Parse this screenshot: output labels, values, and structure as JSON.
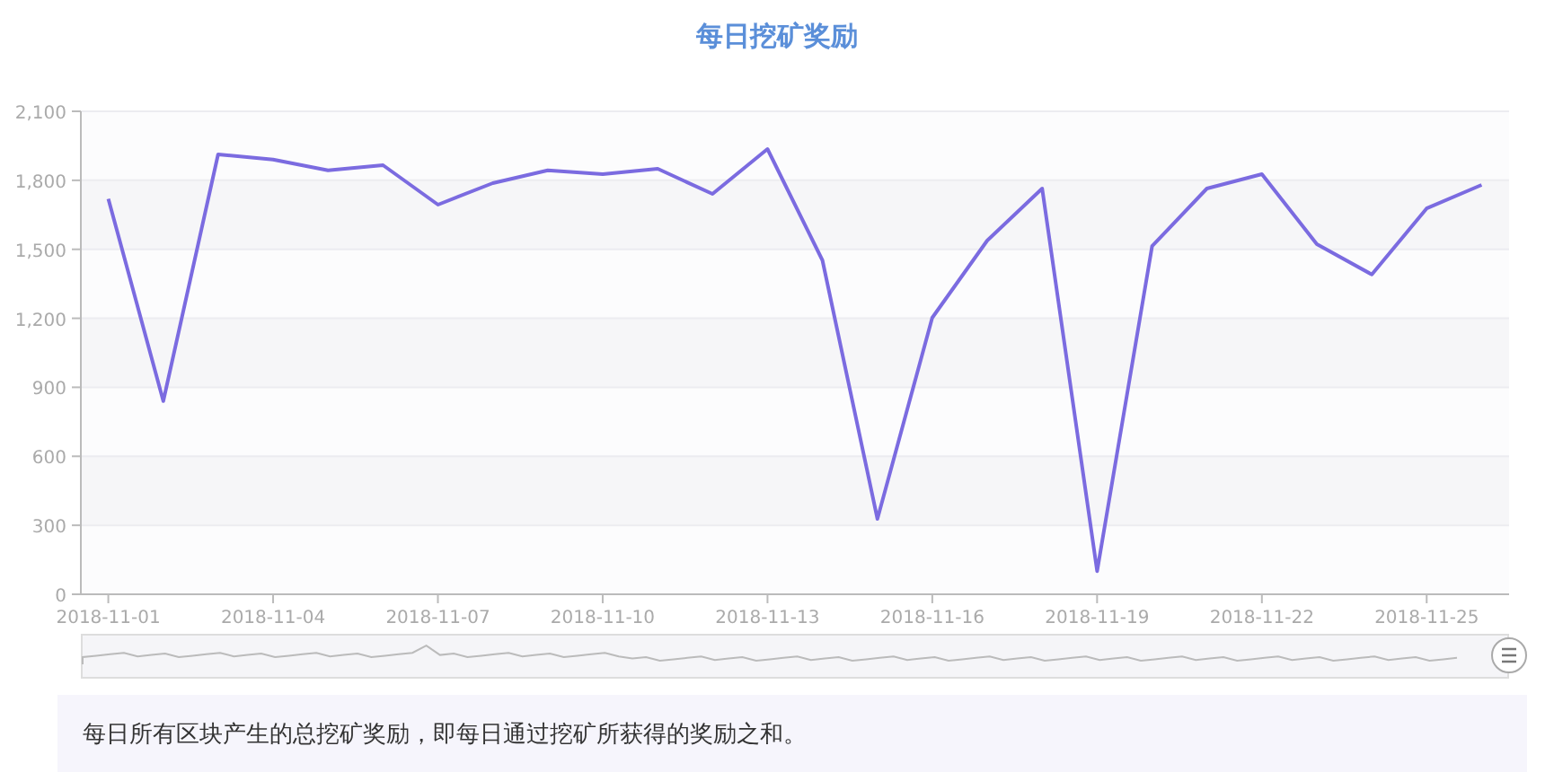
{
  "title": "每日挖矿奖励",
  "chart": {
    "chart_data": {
      "type": "line",
      "categories": [
        "2018-11-01",
        null,
        null,
        "2018-11-04",
        null,
        null,
        "2018-11-07",
        null,
        null,
        "2018-11-10",
        null,
        null,
        "2018-11-13",
        null,
        null,
        "2018-11-16",
        null,
        null,
        "2018-11-19",
        null,
        null,
        "2018-11-22",
        null,
        null,
        "2018-11-25",
        null
      ],
      "series": [
        {
          "color": "#7b6be0",
          "values": [
            1720,
            840,
            1913,
            1890,
            1843,
            1866,
            1694,
            1788,
            1843,
            1827,
            1850,
            1741,
            1936,
            1452,
            328,
            1202,
            1538,
            1764,
            101,
            1514,
            1764,
            1827,
            1522,
            1390,
            1678,
            1780
          ]
        }
      ],
      "ylim": [
        0,
        2100
      ],
      "grid": true,
      "yticks": [
        {
          "value": 0,
          "label": "0"
        },
        {
          "value": 300,
          "label": "300"
        },
        {
          "value": 600,
          "label": "600"
        },
        {
          "value": 900,
          "label": "900"
        },
        {
          "value": 1200,
          "label": "1,200"
        },
        {
          "value": 1500,
          "label": "1,500"
        },
        {
          "value": 1800,
          "label": "1,800"
        },
        {
          "value": 2100,
          "label": "2,100"
        }
      ]
    }
  },
  "zoom_slider": {
    "level": 1
  },
  "description": "每日所有区块产生的总挖矿奖励，即每日通过挖矿所获得的奖励之和。"
}
